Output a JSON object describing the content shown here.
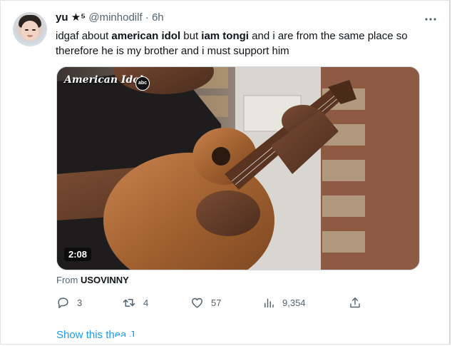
{
  "tweet": {
    "author": {
      "display_name": "yu",
      "badge": "★⁵",
      "handle": "@minhodilf",
      "separator": "·",
      "time": "6h"
    },
    "more_icon": "more-horizontal-icon",
    "text": {
      "part1": "idgaf about ",
      "bold1": "american idol",
      "part2": " but ",
      "bold2": "iam tongi",
      "part3": " and i are from the same place so therefore he is my brother and i must support him"
    },
    "media": {
      "watermark": "American Idol",
      "network_badge": "abc",
      "duration": "2:08"
    },
    "source": {
      "prefix": "From ",
      "name": "USOVINNY"
    },
    "actions": {
      "replies": "3",
      "retweets": "4",
      "likes": "57",
      "views": "9,354"
    },
    "show_thread": "Show this th",
    "show_thread_clip": "ea J"
  },
  "colors": {
    "text_primary": "#0f1419",
    "text_secondary": "#536471",
    "link": "#1d9bf0",
    "border": "#cfd9de"
  }
}
